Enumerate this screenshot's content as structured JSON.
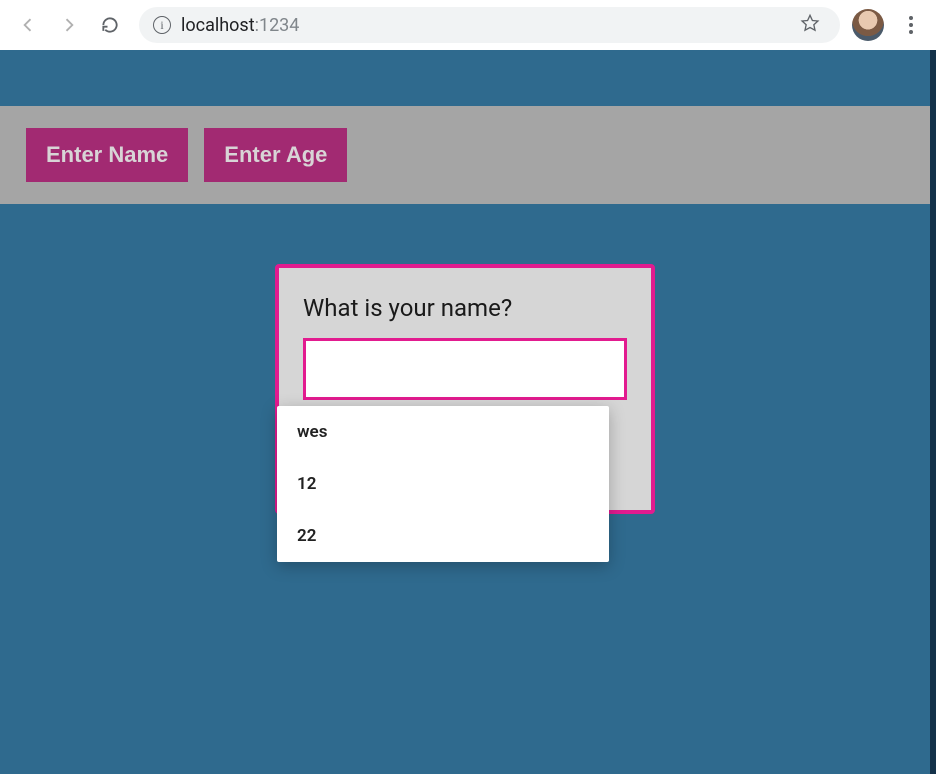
{
  "browser": {
    "url_host": "localhost",
    "url_port": ":1234",
    "info_glyph": "i"
  },
  "buttons": {
    "enter_name": "Enter Name",
    "enter_age": "Enter Age"
  },
  "dialog": {
    "title": "What is your name?",
    "input_value": ""
  },
  "autocomplete": {
    "items": [
      "wes",
      "12",
      "22"
    ]
  }
}
